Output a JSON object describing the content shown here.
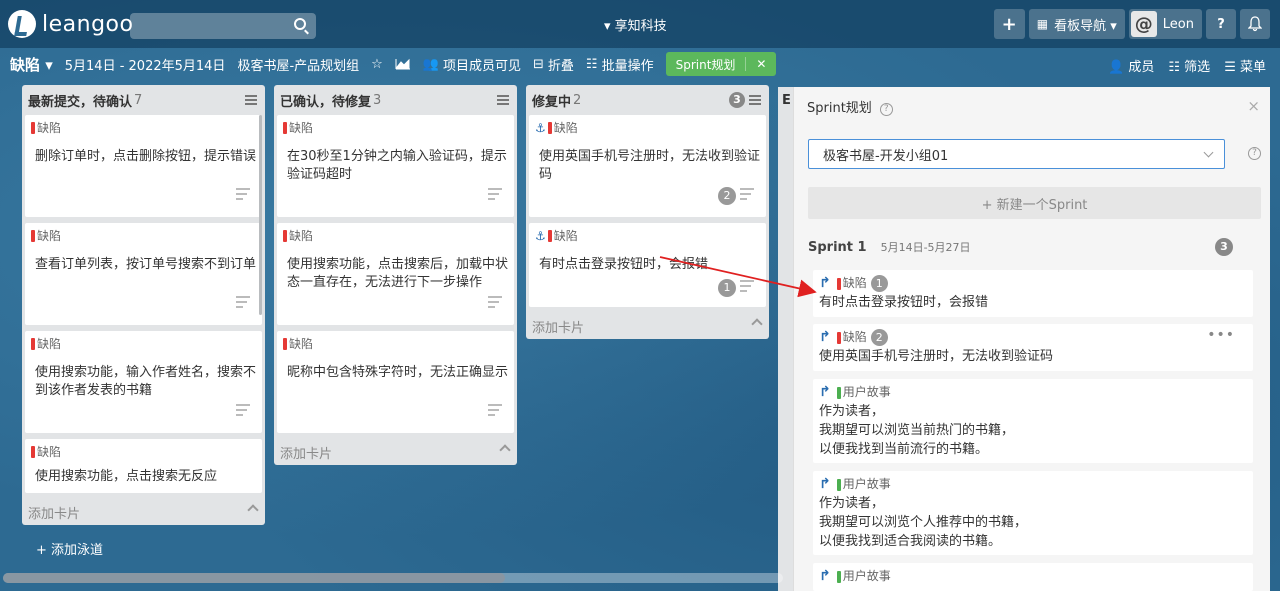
{
  "topbar": {
    "logo": "leangoo",
    "org": "▾ 享知科技",
    "add": "+",
    "board_nav": "看板导航 ▾",
    "user": "Leon",
    "help": "?",
    "bell": "🔔"
  },
  "boardbar": {
    "title": "缺陷 ▾",
    "date_range": "5月14日 - 2022年5月14日",
    "project": "极客书屋-产品规划组",
    "visibility": "项目成员可见",
    "collapse": "折叠",
    "batch": "批量操作",
    "sprint_tag": "Sprint规划",
    "sprint_close": "✕",
    "members": "成员",
    "filter": "筛选",
    "menu": "菜单"
  },
  "lanes": [
    {
      "title": "最新提交，待确认",
      "count": "7",
      "cards": [
        {
          "tag": "缺陷",
          "text": "删除订单时，点击删除按钮，提示错误"
        },
        {
          "tag": "缺陷",
          "text": "查看订单列表，按订单号搜索不到订单"
        },
        {
          "tag": "缺陷",
          "text": "使用搜索功能，输入作者姓名，搜索不到该作者发表的书籍"
        },
        {
          "tag": "缺陷",
          "text": "使用搜索功能，点击搜索无反应"
        }
      ],
      "add_card": "添加卡片"
    },
    {
      "title": "已确认，待修复",
      "count": "3",
      "cards": [
        {
          "tag": "缺陷",
          "text": "在30秒至1分钟之内输入验证码，提示验证码超时"
        },
        {
          "tag": "缺陷",
          "text": "使用搜索功能，点击搜索后，加载中状态一直存在，无法进行下一步操作"
        },
        {
          "tag": "缺陷",
          "text": "昵称中包含特殊字符时，无法正确显示"
        }
      ],
      "add_card": "添加卡片"
    },
    {
      "title": "修复中",
      "count": "2",
      "badge": "3",
      "cards": [
        {
          "tag": "缺陷",
          "text": "使用英国手机号注册时，无法收到验证码",
          "num": "2"
        },
        {
          "tag": "缺陷",
          "text": "有时点击登录按钮时，会报错",
          "num": "1"
        }
      ],
      "add_card": "添加卡片"
    }
  ],
  "add_lane": "+ 添加泳道",
  "partial_lane_title": "E",
  "panel": {
    "title": "Sprint规划",
    "close": "×",
    "select_value": "极客书屋-开发小组01",
    "new_sprint": "+ 新建一个Sprint",
    "sprint_name": "Sprint 1",
    "sprint_date": "5月14日-5月27日",
    "sprint_count": "3",
    "cards": [
      {
        "tag": "缺陷",
        "num": "1",
        "text": [
          "有时点击登录按钮时，会报错"
        ]
      },
      {
        "tag": "缺陷",
        "num": "2",
        "text": [
          "使用英国手机号注册时，无法收到验证码"
        ]
      },
      {
        "tag": "用户故事",
        "text": [
          "作为读者，",
          "我期望可以浏览当前热门的书籍，",
          "以便我找到当前流行的书籍。"
        ]
      },
      {
        "tag": "用户故事",
        "text": [
          "作为读者，",
          "我期望可以浏览个人推荐中的书籍，",
          "以便我找到适合我阅读的书籍。"
        ]
      },
      {
        "tag": "用户故事",
        "text": []
      }
    ]
  },
  "colors": {
    "defect": "#e53935",
    "story": "#4caf50",
    "accent": "#5cb85c",
    "arrow": "#e02020"
  }
}
